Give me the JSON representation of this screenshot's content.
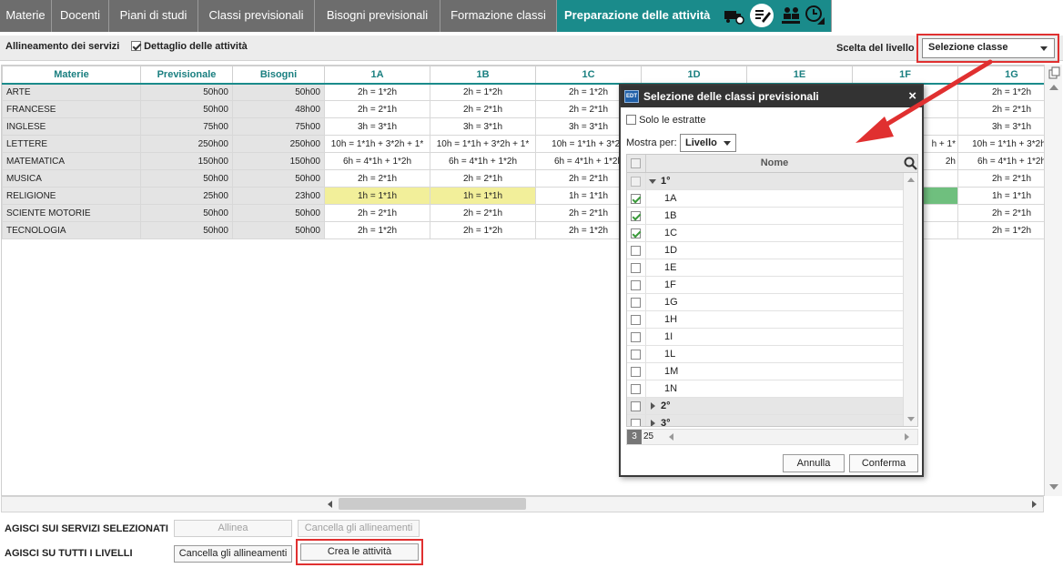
{
  "tabs": {
    "items": [
      "Materie",
      "Docenti",
      "Piani di studi",
      "Classi previsionali",
      "Bisogni previsionali",
      "Formazione classi"
    ],
    "active": "Preparazione delle attività"
  },
  "toolbar": {
    "allineamento": "Allineamento dei servizi",
    "dettaglio": "Dettaglio delle attività",
    "scelta": "Scelta del livello",
    "combo_value": "Selezione classe"
  },
  "grid": {
    "headers": [
      "Materie",
      "Previsionale",
      "Bisogni",
      "1A",
      "1B",
      "1C",
      "1D",
      "1E",
      "1F",
      "1G"
    ],
    "rows": [
      {
        "materia": "ARTE",
        "prev": "50h00",
        "bis": "50h00",
        "a": "2h = 1*2h",
        "b": "2h = 1*2h",
        "c": "2h = 1*2h",
        "g": "2h = 1*2h"
      },
      {
        "materia": "FRANCESE",
        "prev": "50h00",
        "bis": "48h00",
        "a": "2h = 2*1h",
        "b": "2h = 2*1h",
        "c": "2h = 2*1h",
        "g": "2h = 2*1h"
      },
      {
        "materia": "INGLESE",
        "prev": "75h00",
        "bis": "75h00",
        "a": "3h = 3*1h",
        "b": "3h = 3*1h",
        "c": "3h = 3*1h",
        "g": "3h = 3*1h"
      },
      {
        "materia": "LETTERE",
        "prev": "250h00",
        "bis": "250h00",
        "a": "10h = 1*1h + 3*2h + 1*",
        "b": "10h = 1*1h + 3*2h + 1*",
        "c": "10h = 1*1h + 3*2h",
        "f": "h + 1*",
        "g": "10h = 1*1h + 3*2h -"
      },
      {
        "materia": "MATEMATICA",
        "prev": "150h00",
        "bis": "150h00",
        "a": "6h = 4*1h + 1*2h",
        "b": "6h = 4*1h + 1*2h",
        "c": "6h = 4*1h + 1*2h",
        "f": "2h",
        "g": "6h = 4*1h + 1*2h"
      },
      {
        "materia": "MUSICA",
        "prev": "50h00",
        "bis": "50h00",
        "a": "2h = 2*1h",
        "b": "2h = 2*1h",
        "c": "2h = 2*1h",
        "g": "2h = 2*1h"
      },
      {
        "materia": "RELIGIONE",
        "prev": "25h00",
        "bis": "23h00",
        "a": "1h = 1*1h",
        "b": "1h = 1*1h",
        "c": "1h = 1*1h",
        "g": "1h = 1*1h"
      },
      {
        "materia": "SCIENTE MOTORIE",
        "prev": "50h00",
        "bis": "50h00",
        "a": "2h = 2*1h",
        "b": "2h = 2*1h",
        "c": "2h = 2*1h",
        "g": "2h = 2*1h"
      },
      {
        "materia": "TECNOLOGIA",
        "prev": "50h00",
        "bis": "50h00",
        "a": "2h = 1*2h",
        "b": "2h = 1*2h",
        "c": "2h = 1*2h",
        "g": "2h = 1*2h"
      }
    ]
  },
  "footer": {
    "row1_label": "AGISCI SUI SERVIZI SELEZIONATI",
    "row2_label": "AGISCI SU TUTTI I LIVELLI",
    "allinea": "Allinea",
    "cancella1": "Cancella gli allineamenti",
    "cancella2": "Cancella gli allineamenti",
    "crea": "Crea le attività"
  },
  "dialog": {
    "logo": "EDT",
    "title": "Selezione delle classi previsionali",
    "close": "×",
    "solo": "Solo le estratte",
    "mostra_label": "Mostra per:",
    "mostra_value": "Livello",
    "col_nome": "Nome",
    "items": [
      {
        "name": "1°",
        "group": true,
        "checked": false,
        "open": true
      },
      {
        "name": "1A",
        "checked": true
      },
      {
        "name": "1B",
        "checked": true
      },
      {
        "name": "1C",
        "checked": true
      },
      {
        "name": "1D",
        "checked": false
      },
      {
        "name": "1E",
        "checked": false
      },
      {
        "name": "1F",
        "checked": false
      },
      {
        "name": "1G",
        "checked": false
      },
      {
        "name": "1H",
        "checked": false
      },
      {
        "name": "1I",
        "checked": false
      },
      {
        "name": "1L",
        "checked": false
      },
      {
        "name": "1M",
        "checked": false
      },
      {
        "name": "1N",
        "checked": false
      },
      {
        "name": "2°",
        "group": true,
        "checked": false,
        "open": false
      },
      {
        "name": "3°",
        "group": true,
        "checked": false,
        "open": false
      }
    ],
    "count_selected": "3",
    "count_total": "25",
    "annulla": "Annulla",
    "conferma": "Conferma"
  },
  "colors": {
    "accent": "#1a8b8b",
    "tab": "#6d6d6d",
    "highlight": "#e03030",
    "yellow": "#f2ef9a",
    "green": "#6fbf7e"
  }
}
